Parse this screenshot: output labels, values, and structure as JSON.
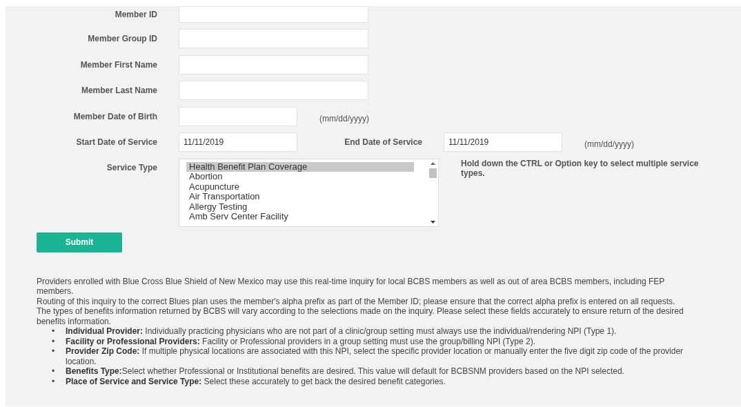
{
  "fields": [
    {
      "label": "Member ID",
      "kind": "text"
    },
    {
      "label": "Member Group ID",
      "kind": "text"
    },
    {
      "label": "Member First Name",
      "kind": "text"
    },
    {
      "label": "Member Last Name",
      "kind": "text"
    },
    {
      "label": "Member Date of Birth",
      "kind": "date",
      "hint": "(mm/dd/yyyy)"
    }
  ],
  "service_dates": {
    "start_label": "Start Date of Service",
    "start_value": "11/11/2019",
    "end_label": "End Date of Service",
    "end_value": "11/11/2019",
    "hint": "(mm/dd/yyyy)"
  },
  "service_type": {
    "label": "Service Type",
    "help": "Hold down the CTRL or Option key to select multiple service types.",
    "options": [
      {
        "label": "Health Benefit Plan Coverage",
        "selected": true
      },
      {
        "label": "Abortion",
        "selected": false
      },
      {
        "label": "Acupuncture",
        "selected": false
      },
      {
        "label": "Air Transportation",
        "selected": false
      },
      {
        "label": "Allergy Testing",
        "selected": false
      },
      {
        "label": "Amb Serv Center Facility",
        "selected": false
      }
    ]
  },
  "submit_button": "Submit",
  "paragraphs": [
    "Providers enrolled with Blue Cross Blue Shield of New Mexico may use this real-time inquiry for local BCBS members as well as out of area BCBS members, including FEP members.",
    "Routing of this inquiry to the correct Blues plan uses the member's alpha prefix as part of the Member ID; please ensure that the correct alpha prefix is entered on all requests.",
    "The types of benefits information returned by BCBS will vary according to the selections made on the inquiry. Please select these fields accurately to ensure return of the desired benefits information."
  ],
  "bullets": [
    {
      "marker": "•",
      "text": "**Individual Provider:** Individually practicing physicians who are not part of a clinic/group setting must always use the individual/rendering NPI (Type 1)."
    },
    {
      "marker": "•",
      "text": "**Facility or Professional Providers:** Facility or Professional providers in a group setting must use the group/billing NPI (Type 2)."
    },
    {
      "marker": "•",
      "text": "**Provider Zip Code:** If multiple physical locations are associated with this NPI, select the specific provider location or manually enter the five digit zip code of the provider location."
    },
    {
      "marker": "•",
      "text": "**Benefits Type:**Select whether Professional or Institutional benefits are desired. This value will default for BCBSNM providers based on the NPI selected."
    },
    {
      "marker": "•",
      "text": "**Place of Service and Service Type:** Select these accurately to get back the desired benefit categories."
    }
  ]
}
